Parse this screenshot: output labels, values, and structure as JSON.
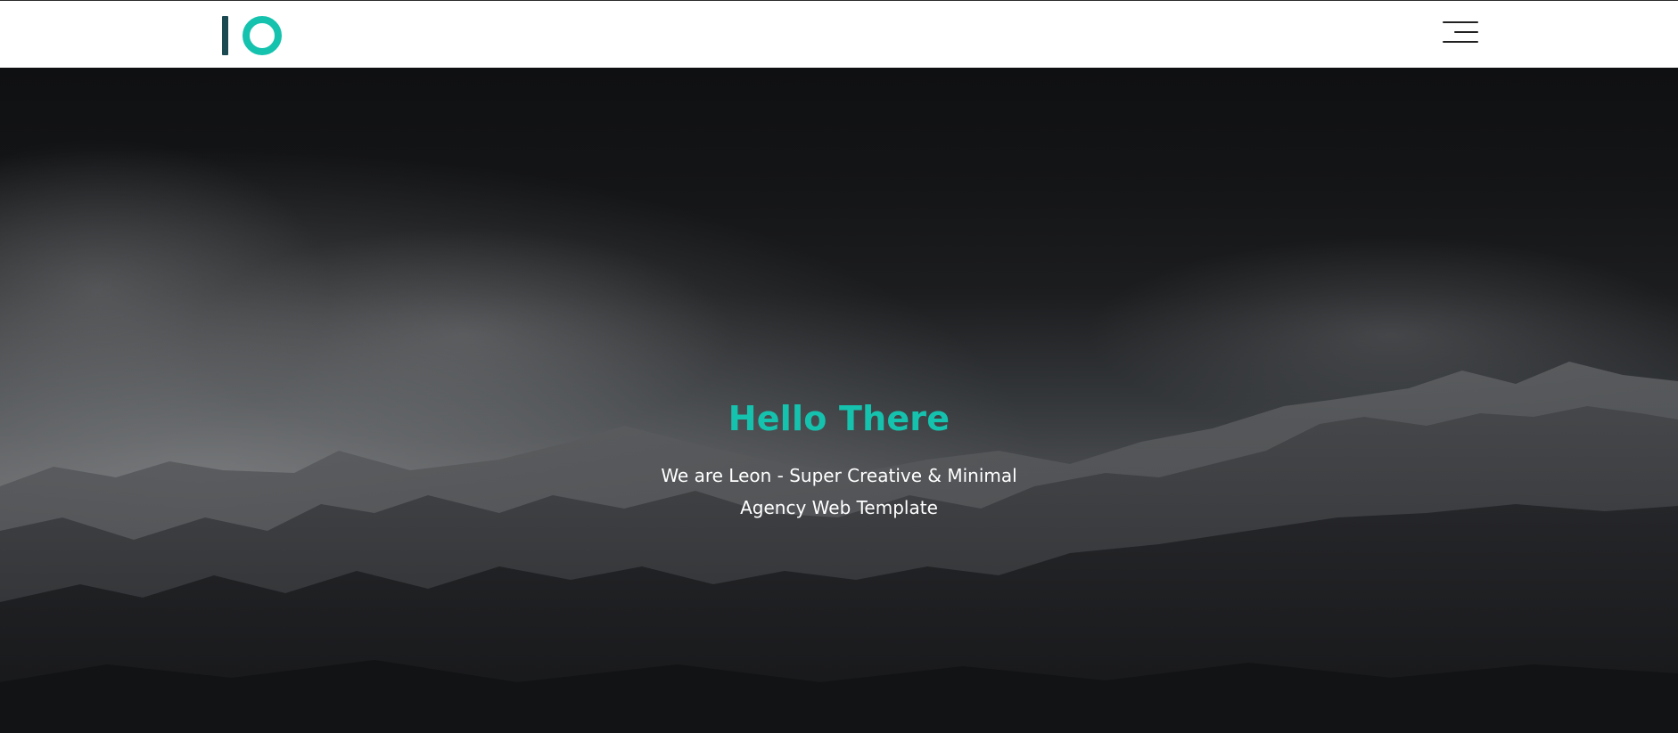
{
  "header": {
    "logo_label": "Leon logo",
    "menu_label": "Open menu"
  },
  "hero": {
    "title": "Hello There",
    "subtitle": "We are Leon - Super Creative & Minimal Agency Web Template"
  },
  "colors": {
    "accent": "#15c2ae",
    "logo_dark": "#1c4a52",
    "header_bg": "#ffffff",
    "hero_text": "#ffffff"
  },
  "icons": [
    "logo-bar-icon",
    "logo-ring-icon",
    "hamburger-menu-icon"
  ]
}
